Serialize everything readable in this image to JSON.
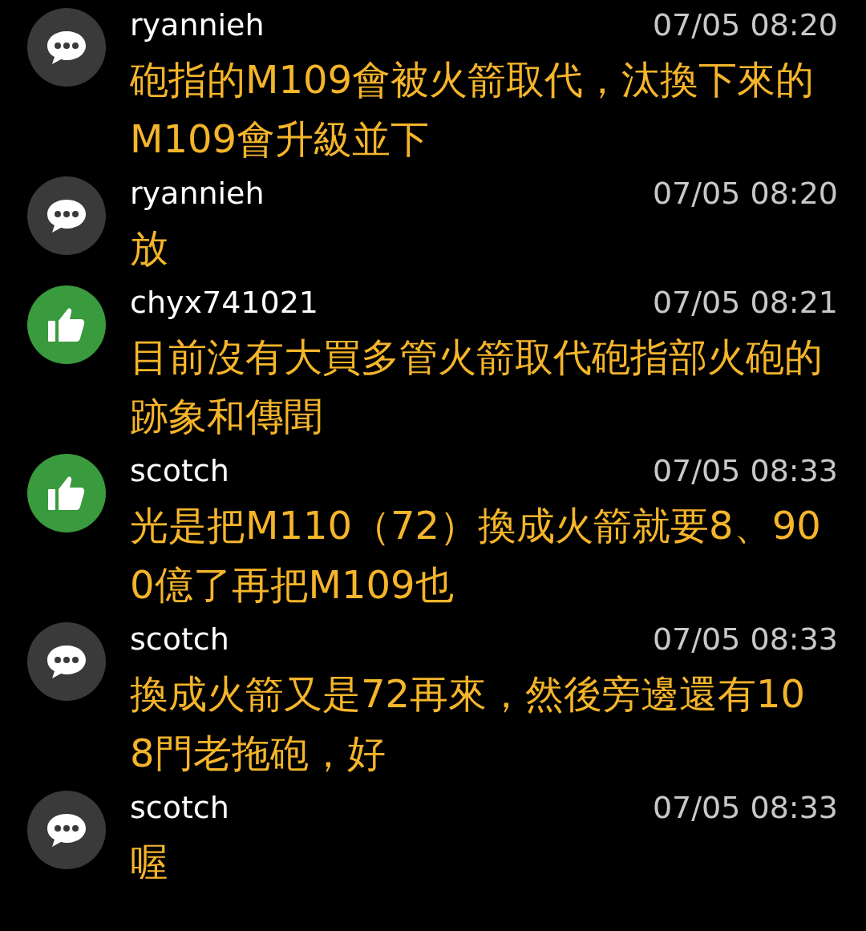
{
  "comments": [
    {
      "kind": "neutral",
      "user": "ryannieh",
      "time": "07/05 08:20",
      "text": "砲指的M109會被火箭取代，汰換下來的M109會升級並下"
    },
    {
      "kind": "neutral",
      "user": "ryannieh",
      "time": "07/05 08:20",
      "text": "放"
    },
    {
      "kind": "push",
      "user": "chyx741021",
      "time": "07/05 08:21",
      "text": "目前沒有大買多管火箭取代砲指部火砲的跡象和傳聞"
    },
    {
      "kind": "push",
      "user": "scotch",
      "time": "07/05 08:33",
      "text": "光是把M110（72）換成火箭就要8、900億了再把M109也"
    },
    {
      "kind": "neutral",
      "user": "scotch",
      "time": "07/05 08:33",
      "text": "換成火箭又是72再來，然後旁邊還有108門老拖砲，好"
    },
    {
      "kind": "neutral",
      "user": "scotch",
      "time": "07/05 08:33",
      "text": "喔"
    }
  ]
}
